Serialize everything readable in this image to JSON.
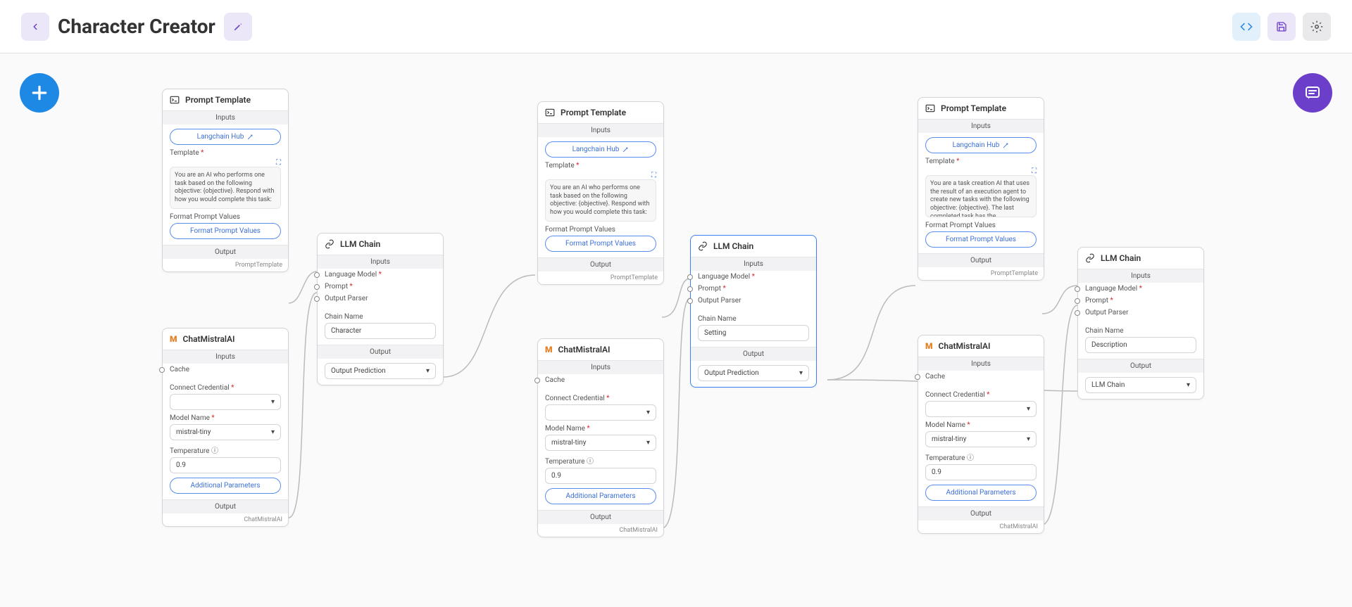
{
  "header": {
    "title": "Character Creator"
  },
  "labels": {
    "inputs": "Inputs",
    "outputs": "Output",
    "langchain_hub": "Langchain Hub",
    "template": "Template",
    "format_prompt": "Format Prompt Values",
    "additional_params": "Additional Parameters",
    "cache": "Cache",
    "connect_cred": "Connect Credential",
    "model_name": "Model Name",
    "temperature": "Temperature",
    "language_model": "Language Model",
    "prompt": "Prompt",
    "output_parser": "Output Parser",
    "chain_name": "Chain Name",
    "prompt_template": "Prompt Template",
    "chat_mistral": "ChatMistralAI",
    "llm_chain": "LLM Chain",
    "output_prediction": "Output Prediction",
    "llm_chain_opt": "LLM Chain",
    "prompt_out": "PromptTemplate",
    "mistral_out": "ChatMistralAI"
  },
  "prompts": {
    "p1": "You are an AI who performs one task based on the following objective: {objective}. Respond with how you would complete this task:",
    "p2": "You are an AI who performs one task based on the following objective: {objective}. Respond with how you would complete this task:",
    "p3": "You are a task creation AI that uses the result of an execution agent to create new tasks with the following objective: {objective}. The last completed task has the"
  },
  "mistral": {
    "model": "mistral-tiny",
    "temp": "0.9"
  },
  "chains": {
    "c1": "Character",
    "c2": "Setting",
    "c3": "Description"
  }
}
